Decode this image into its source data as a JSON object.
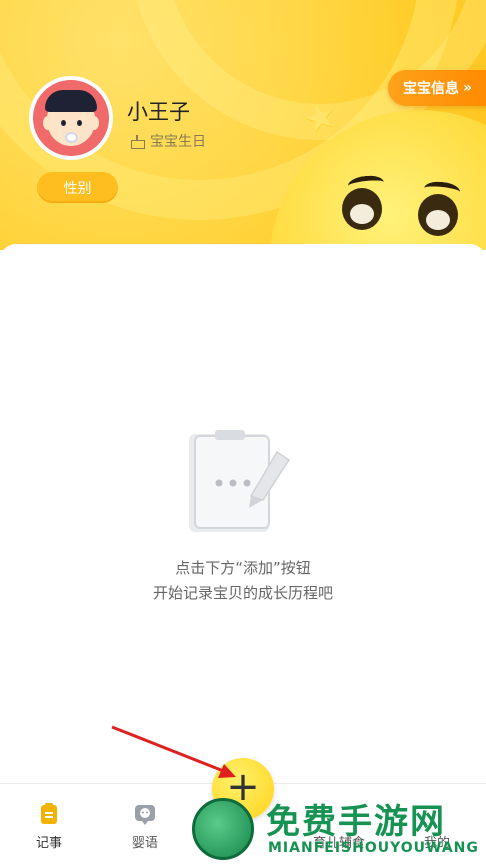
{
  "header": {
    "baby_name": "小王子",
    "birthday_label": "宝宝生日",
    "gender_label": "性别",
    "info_button_label": "宝宝信息",
    "info_button_chevron": "»"
  },
  "empty_state": {
    "line1": "点击下方“添加”按钮",
    "line2": "开始记录宝贝的成长历程吧"
  },
  "tabbar": {
    "tabs": [
      {
        "label": "记事",
        "icon": "notebook-icon",
        "active": true
      },
      {
        "label": "婴语",
        "icon": "baby-voice-icon",
        "active": false
      },
      {
        "label": "育儿辅食",
        "icon": "baby-food-icon",
        "active": false
      },
      {
        "label": "我的",
        "icon": "profile-icon",
        "active": false
      }
    ],
    "add_label": "+"
  },
  "watermark": {
    "title": "免费手游网",
    "subtitle": "MIANFEISHOUYOUWANG"
  },
  "colors": {
    "header_yellow": "#ffcd2a",
    "accent_orange": "#ff8a00",
    "active_tab": "#f2b300",
    "annotation_arrow": "#e02020",
    "watermark_green": "#169352"
  }
}
